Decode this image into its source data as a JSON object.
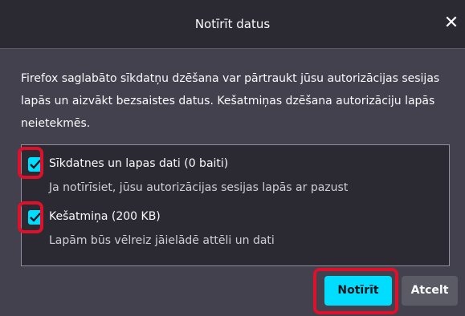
{
  "dialog": {
    "title": "Notīrīt datus",
    "close_icon": "close-icon",
    "description": "Firefox saglabāto sīkdatņu dzēšana var pārtraukt jūsu autorizācijas sesijas lapās un aizvākt bezsaistes datus. Kešatmiņas dzēšana autorizāciju lapās neietekmēs.",
    "options": [
      {
        "label": "Sīkdatnes un lapas dati (0 baiti)",
        "sub": "Ja notīrīsiet, jūsu autorizācijas sesijas lapās ar pazust",
        "checked": true
      },
      {
        "label": "Kešatmiņa (200 KB)",
        "sub": "Lapām būs vēlreiz jāielādē attēli un dati",
        "checked": true
      }
    ],
    "buttons": {
      "clear_label": "Notīrīt",
      "cancel_label": "Atcelt"
    }
  },
  "colors": {
    "accent": "#00ddff",
    "highlight": "#e0102a",
    "background": "#42414d"
  }
}
